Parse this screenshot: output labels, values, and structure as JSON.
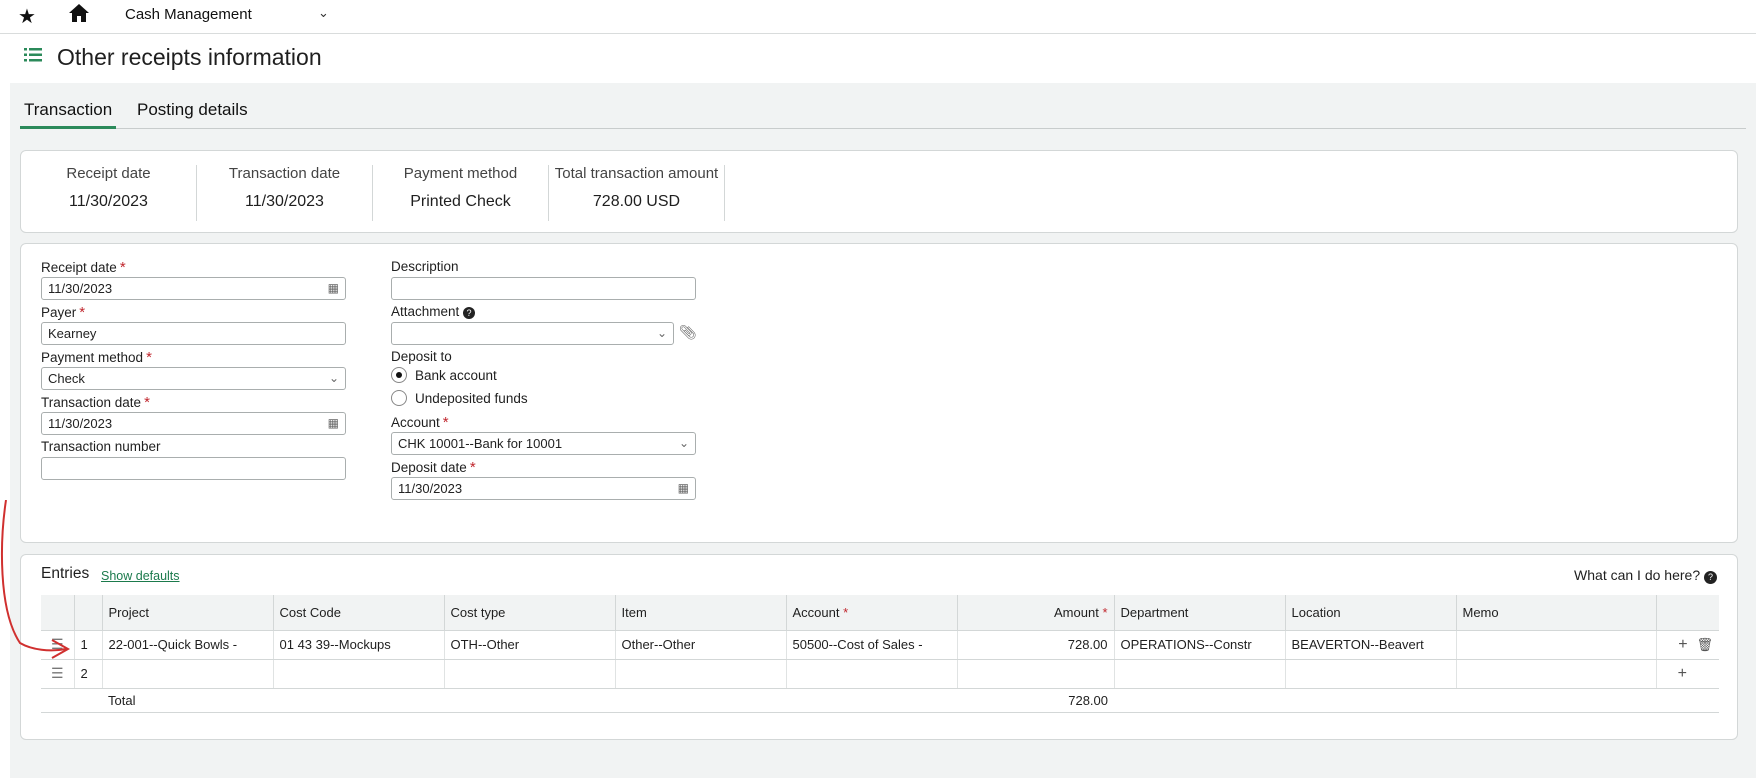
{
  "topbar": {
    "module": "Cash Management"
  },
  "page": {
    "title": "Other receipts information"
  },
  "tabs": [
    {
      "label": "Transaction"
    },
    {
      "label": "Posting details"
    }
  ],
  "summary": [
    {
      "label": "Receipt date",
      "value": "11/30/2023"
    },
    {
      "label": "Transaction date",
      "value": "11/30/2023"
    },
    {
      "label": "Payment method",
      "value": "Printed Check"
    },
    {
      "label": "Total transaction amount",
      "value": "728.00 USD"
    }
  ],
  "form": {
    "receipt_date": {
      "label": "Receipt date",
      "value": "11/30/2023"
    },
    "payer": {
      "label": "Payer",
      "value": "Kearney"
    },
    "payment_method": {
      "label": "Payment method",
      "value": "Check"
    },
    "transaction_date": {
      "label": "Transaction date",
      "value": "11/30/2023"
    },
    "transaction_number": {
      "label": "Transaction number",
      "value": ""
    },
    "description": {
      "label": "Description",
      "value": ""
    },
    "attachment": {
      "label": "Attachment",
      "value": ""
    },
    "deposit_to": {
      "label": "Deposit to",
      "options": [
        "Bank account",
        "Undeposited funds"
      ],
      "selected": "Bank account"
    },
    "account": {
      "label": "Account",
      "value": "CHK 10001--Bank for 10001"
    },
    "deposit_date": {
      "label": "Deposit date",
      "value": "11/30/2023"
    }
  },
  "entries": {
    "title": "Entries",
    "show_defaults": "Show defaults",
    "help": "What can I do here?",
    "columns": [
      "Project",
      "Cost Code",
      "Cost type",
      "Item",
      "Account",
      "Amount",
      "Department",
      "Location",
      "Memo"
    ],
    "rows": [
      {
        "num": "1",
        "project": "22-001--Quick Bowls -",
        "cost_code": "01 43 39--Mockups",
        "cost_type": "OTH--Other",
        "item": "Other--Other",
        "account": "50500--Cost of Sales -",
        "amount": "728.00",
        "department": "OPERATIONS--Constr",
        "location": "BEAVERTON--Beavert",
        "memo": ""
      },
      {
        "num": "2",
        "project": "",
        "cost_code": "",
        "cost_type": "",
        "item": "",
        "account": "",
        "amount": "",
        "department": "",
        "location": "",
        "memo": ""
      }
    ],
    "total_label": "Total",
    "total_amount": "728.00"
  },
  "colors": {
    "accent": "#2b8a5a",
    "required": "#c0262d",
    "annotation": "#d0302f"
  }
}
